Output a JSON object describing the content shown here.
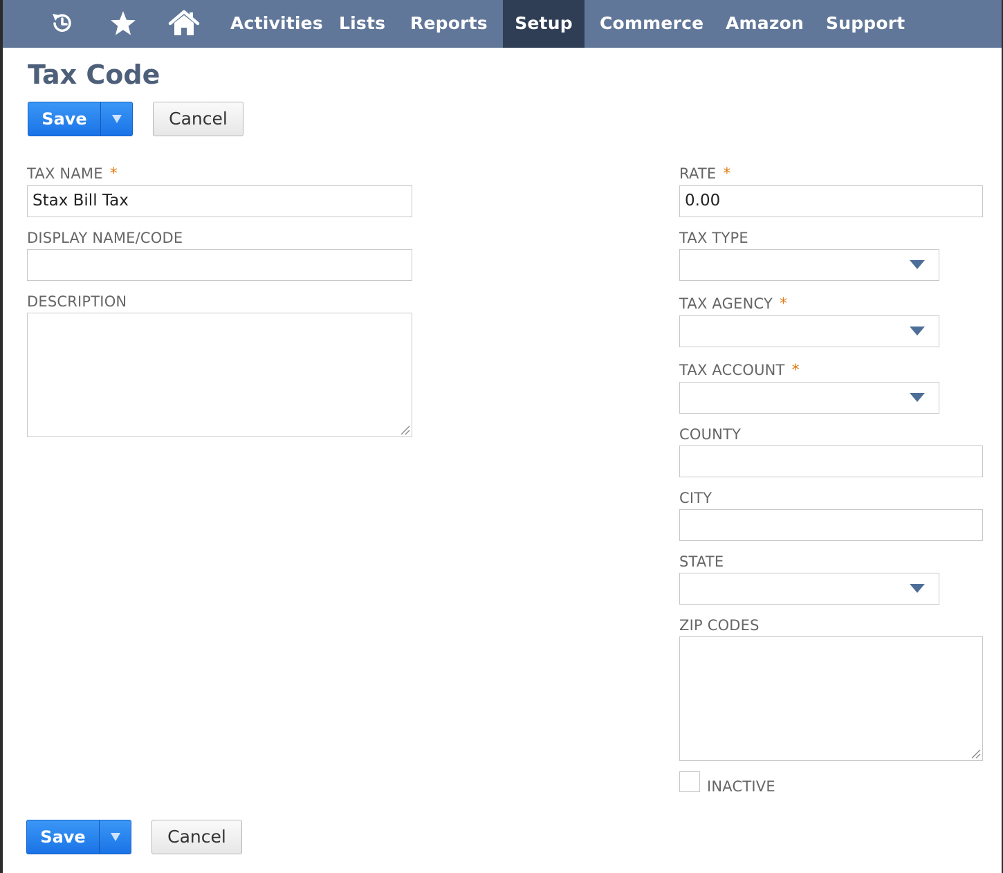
{
  "nav": {
    "icons": [
      "recent-history-icon",
      "favorites-star-icon",
      "home-icon"
    ],
    "items": [
      {
        "label": "Activities"
      },
      {
        "label": "Lists"
      },
      {
        "label": "Reports"
      },
      {
        "label": "Setup",
        "active": true
      },
      {
        "label": "Commerce"
      },
      {
        "label": "Amazon"
      },
      {
        "label": "Support"
      }
    ],
    "bar_color": "#607799",
    "active_color": "#2f3e55"
  },
  "page": {
    "title": "Tax Code"
  },
  "buttons": {
    "save_label": "Save",
    "cancel_label": "Cancel"
  },
  "form": {
    "tax_name": {
      "label": "TAX NAME",
      "required_mark": "*",
      "value": "Stax Bill Tax"
    },
    "display_name": {
      "label": "DISPLAY NAME/CODE",
      "value": ""
    },
    "description": {
      "label": "DESCRIPTION",
      "value": ""
    },
    "rate": {
      "label": "RATE",
      "required_mark": "*",
      "value": "0.00"
    },
    "tax_type": {
      "label": "TAX TYPE",
      "value": ""
    },
    "tax_agency": {
      "label": "TAX AGENCY",
      "required_mark": "*",
      "value": ""
    },
    "tax_account": {
      "label": "TAX ACCOUNT",
      "required_mark": "*",
      "value": ""
    },
    "county": {
      "label": "COUNTY",
      "value": ""
    },
    "city": {
      "label": "CITY",
      "value": ""
    },
    "state": {
      "label": "STATE",
      "value": ""
    },
    "zip_codes": {
      "label": "ZIP CODES",
      "value": ""
    },
    "inactive": {
      "label": "INACTIVE",
      "checked": false
    }
  },
  "colors": {
    "primary_button": "#1a73e6",
    "required": "#e07b12",
    "title": "#4d5f79"
  }
}
